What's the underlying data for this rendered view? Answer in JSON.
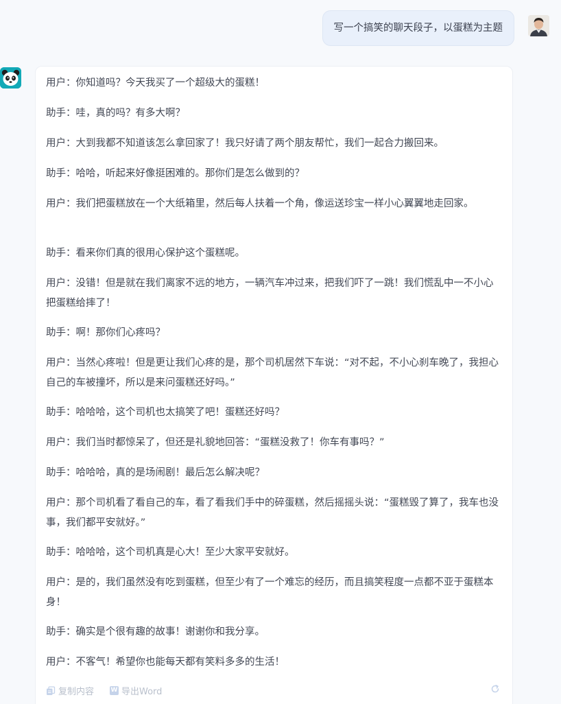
{
  "user_message": {
    "text": "写一个搞笑的聊天段子，以蛋糕为主题"
  },
  "assistant_message": {
    "lines": [
      "用户：你知道吗？今天我买了一个超级大的蛋糕！",
      "助手：哇，真的吗？有多大啊？",
      "用户：大到我都不知道该怎么拿回家了！我只好请了两个朋友帮忙，我们一起合力搬回来。",
      "助手：哈哈，听起来好像挺困难的。那你们是怎么做到的？",
      "用户：我们把蛋糕放在一个大纸箱里，然后每人扶着一个角，像运送珍宝一样小心翼翼地走回家。",
      "助手：看来你们真的很用心保护这个蛋糕呢。",
      "用户：没错！但是就在我们离家不远的地方，一辆汽车冲过来，把我们吓了一跳！我们慌乱中一不小心把蛋糕给摔了！",
      "助手：啊！那你们心疼吗？",
      "用户：当然心疼啦！但是更让我们心疼的是，那个司机居然下车说：“对不起，不小心刹车晚了，我担心自己的车被撞坏，所以是来问蛋糕还好吗。”",
      "助手：哈哈哈，这个司机也太搞笑了吧！蛋糕还好吗？",
      "用户：我们当时都惊呆了，但还是礼貌地回答：“蛋糕没救了！你车有事吗？”",
      "助手：哈哈哈，真的是场闹剧！最后怎么解决呢？",
      "用户：那个司机看了看自己的车，看了看我们手中的碎蛋糕，然后摇摇头说：“蛋糕毁了算了，我车也没事，我们都平安就好。”",
      "助手：哈哈哈，这个司机真是心大！至少大家平安就好。",
      "用户：是的，我们虽然没有吃到蛋糕，但至少有了一个难忘的经历，而且搞笑程度一点都不亚于蛋糕本身！",
      "助手：确实是个很有趣的故事！谢谢你和我分享。",
      "用户：不客气！希望你也能每天都有笑料多多的生活！"
    ]
  },
  "actions": {
    "copy_label": "复制内容",
    "export_label": "导出Word",
    "copy_icon": "copy-icon",
    "word_icon": "word-icon",
    "refresh_icon": "refresh-icon"
  },
  "colors": {
    "background": "#f7f9fc",
    "user_bubble": "#e9f0fb",
    "card": "#ffffff",
    "text": "#434855",
    "muted": "#b9c0cc",
    "bot_avatar": "#12a9b7"
  }
}
